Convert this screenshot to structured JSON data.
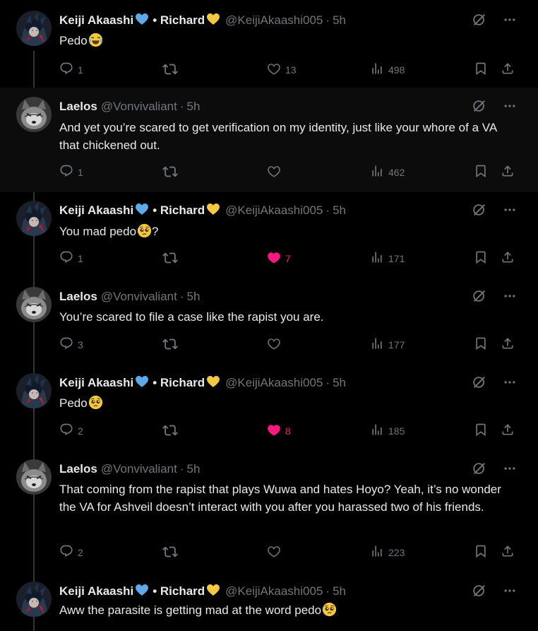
{
  "tweets": [
    {
      "name": "Keiji Akaashi",
      "sep": "• Richard",
      "handle": "@KeijiAkaashi005",
      "time": "5h",
      "text": "Pedo",
      "emoji": "joy",
      "replies": "1",
      "likes": "13",
      "liked": false,
      "views": "498",
      "highlight": false,
      "avatar": "keiji"
    },
    {
      "name": "Laelos",
      "sep": "",
      "handle": "@Vonvivaliant",
      "time": "5h",
      "text": "And yet you’re scared to get verification on my identity, just like your whore of a VA that chickened out.",
      "emoji": "",
      "replies": "1",
      "likes": "",
      "liked": false,
      "views": "462",
      "highlight": true,
      "avatar": "laelos"
    },
    {
      "name": "Keiji Akaashi",
      "sep": "• Richard",
      "handle": "@KeijiAkaashi005",
      "time": "5h",
      "text": "You mad pedo",
      "emoji": "pleading",
      "suffix": "?",
      "replies": "1",
      "likes": "7",
      "liked": true,
      "views": "171",
      "highlight": false,
      "avatar": "keiji"
    },
    {
      "name": "Laelos",
      "sep": "",
      "handle": "@Vonvivaliant",
      "time": "5h",
      "text": "You’re scared to file a case like the rapist you are.",
      "emoji": "",
      "replies": "3",
      "likes": "",
      "liked": false,
      "views": "177",
      "highlight": false,
      "avatar": "laelos"
    },
    {
      "name": "Keiji Akaashi",
      "sep": "• Richard",
      "handle": "@KeijiAkaashi005",
      "time": "5h",
      "text": "Pedo",
      "emoji": "pleading",
      "replies": "2",
      "likes": "8",
      "liked": true,
      "views": "185",
      "highlight": false,
      "avatar": "keiji"
    },
    {
      "name": "Laelos",
      "sep": "",
      "handle": "@Vonvivaliant",
      "time": "5h",
      "text": "That coming from the rapist that plays Wuwa and hates Hoyo? Yeah, it’s no wonder the VA for Ashveil doesn’t interact with you after you harassed two of his friends.",
      "emoji": "",
      "replies": "2",
      "likes": "",
      "liked": false,
      "views": "223",
      "highlight": false,
      "avatar": "laelos"
    },
    {
      "name": "Keiji Akaashi",
      "sep": "• Richard",
      "handle": "@KeijiAkaashi005",
      "time": "5h",
      "text": "Aww the parasite is getting mad at the word pedo",
      "emoji": "pleading",
      "replies": "",
      "likes": "",
      "liked": false,
      "views": "",
      "highlight": false,
      "avatar": "keiji",
      "noActions": true
    }
  ],
  "colors": {
    "accent": "#1d9bf0",
    "like": "#f91880",
    "muted": "#71767b",
    "blueHeart": "#5da9e9",
    "yellowHeart": "#f5c842"
  }
}
